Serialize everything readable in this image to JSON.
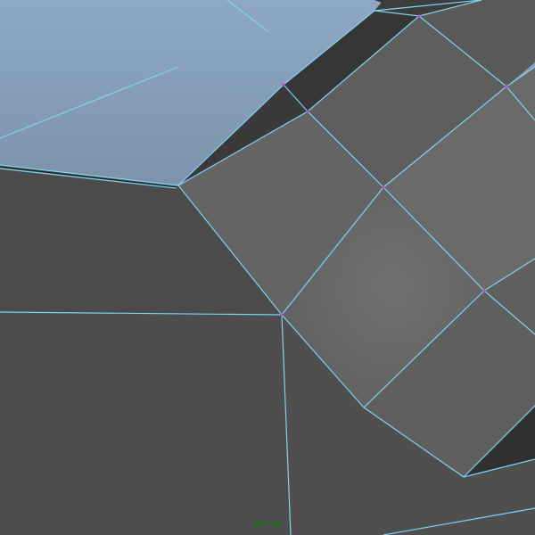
{
  "viewport": {
    "camera_label": "persp"
  },
  "colors": {
    "wire": "#7fd3ef",
    "vertex": "#c24bd6",
    "background_gradient_top": "#8aa3bf",
    "background_gradient_bottom": "#5d6d7d",
    "face_dark": "#4b4b4b",
    "face_mid": "#626262",
    "face_light": "#6b6b6b"
  }
}
